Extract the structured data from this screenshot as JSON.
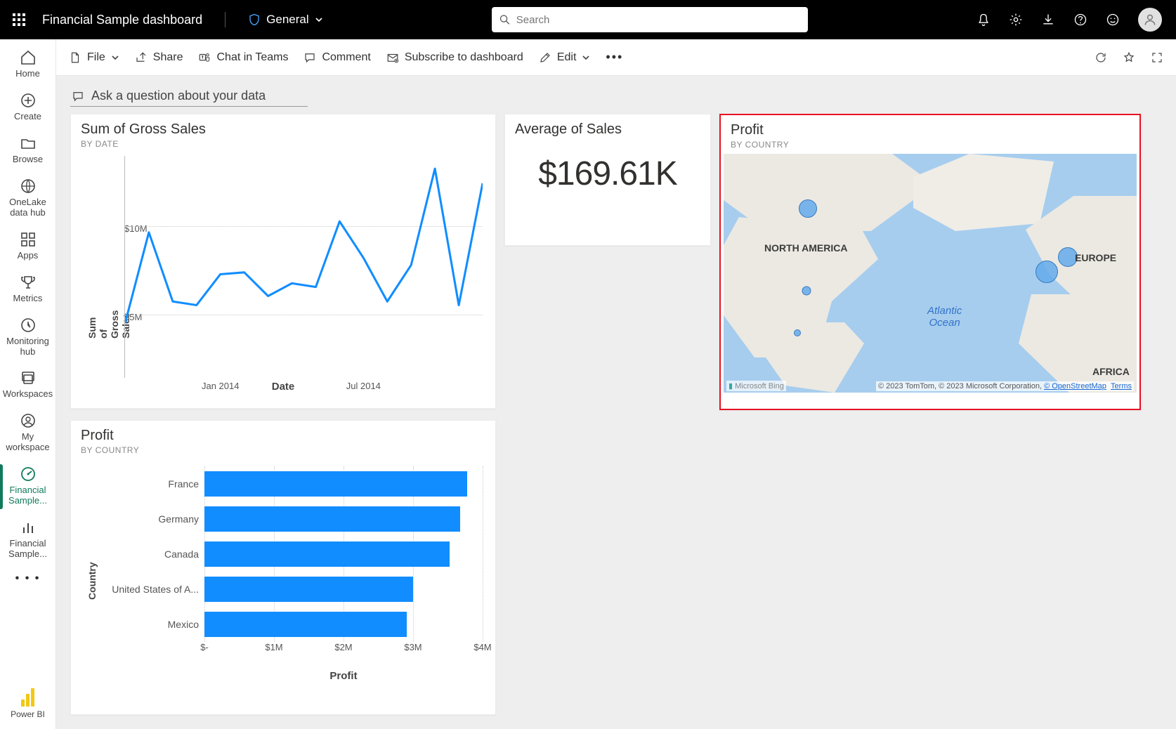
{
  "header": {
    "title": "Financial Sample  dashboard",
    "sensitivity": "General",
    "search_placeholder": "Search"
  },
  "nav": {
    "items": [
      {
        "label": "Home"
      },
      {
        "label": "Create"
      },
      {
        "label": "Browse"
      },
      {
        "label": "OneLake data hub"
      },
      {
        "label": "Apps"
      },
      {
        "label": "Metrics"
      },
      {
        "label": "Monitoring hub"
      },
      {
        "label": "Workspaces"
      },
      {
        "label": "My workspace"
      },
      {
        "label": "Financial Sample..."
      },
      {
        "label": "Financial Sample..."
      }
    ],
    "footer": "Power BI"
  },
  "toolbar": {
    "file": "File",
    "share": "Share",
    "chat": "Chat in Teams",
    "comment": "Comment",
    "subscribe": "Subscribe to dashboard",
    "edit": "Edit"
  },
  "qna": "Ask a question about your data",
  "tiles": {
    "gross_sales": {
      "title": "Sum of Gross Sales",
      "sub": "BY DATE",
      "xlabel": "Date",
      "ylabel": "Sum of Gross Sales"
    },
    "avg_sales": {
      "title": "Average of Sales",
      "value": "$169.61K"
    },
    "profit_map": {
      "title": "Profit",
      "sub": "BY COUNTRY",
      "na": "NORTH AMERICA",
      "eu": "EUROPE",
      "af": "AFRICA",
      "ocean1": "Atlantic",
      "ocean2": "Ocean",
      "bing": "Microsoft Bing",
      "attr1": "© 2023 TomTom, © 2023 Microsoft Corporation, ",
      "attr2": "© OpenStreetMap",
      "attr3": "Terms"
    },
    "profit_bar": {
      "title": "Profit",
      "sub": "BY COUNTRY",
      "xlabel": "Profit",
      "ylabel": "Country"
    }
  },
  "chart_data": [
    {
      "id": "gross_sales_line",
      "type": "line",
      "title": "Sum of Gross Sales",
      "xlabel": "Date",
      "ylabel": "Sum of Gross Sales",
      "y_ticks": [
        "$5M",
        "$10M"
      ],
      "y_tick_values": [
        5,
        10
      ],
      "ylim": [
        3,
        14
      ],
      "x_ticks": [
        "Jan 2014",
        "Jul 2014"
      ],
      "x": [
        "2013-09",
        "2013-10",
        "2013-11",
        "2013-12",
        "2014-01",
        "2014-02",
        "2014-03",
        "2014-04",
        "2014-05",
        "2014-06",
        "2014-07",
        "2014-08",
        "2014-09",
        "2014-10",
        "2014-11",
        "2014-12"
      ],
      "y": [
        4.8,
        9.8,
        6.0,
        5.8,
        7.5,
        7.6,
        6.3,
        7.0,
        6.8,
        10.4,
        8.4,
        6.0,
        8.0,
        13.3,
        5.8,
        12.5
      ]
    },
    {
      "id": "avg_sales_kpi",
      "type": "kpi",
      "title": "Average of Sales",
      "value": 169610,
      "display": "$169.61K"
    },
    {
      "id": "profit_by_country_map",
      "type": "map",
      "title": "Profit by Country",
      "series": [
        {
          "country": "France",
          "profit": 3.78
        },
        {
          "country": "Germany",
          "profit": 3.68
        },
        {
          "country": "Canada",
          "profit": 3.53
        },
        {
          "country": "United States of America",
          "profit": 3.0
        },
        {
          "country": "Mexico",
          "profit": 2.91
        }
      ],
      "unit": "$M"
    },
    {
      "id": "profit_by_country_bar",
      "type": "bar",
      "orientation": "horizontal",
      "title": "Profit",
      "xlabel": "Profit",
      "ylabel": "Country",
      "x_ticks": [
        "$-",
        "$1M",
        "$2M",
        "$3M",
        "$4M"
      ],
      "x_tick_values": [
        0,
        1,
        2,
        3,
        4
      ],
      "xlim": [
        0,
        4
      ],
      "categories": [
        "France",
        "Germany",
        "Canada",
        "United States of A...",
        "Mexico"
      ],
      "values": [
        3.78,
        3.68,
        3.53,
        3.0,
        2.91
      ]
    }
  ]
}
